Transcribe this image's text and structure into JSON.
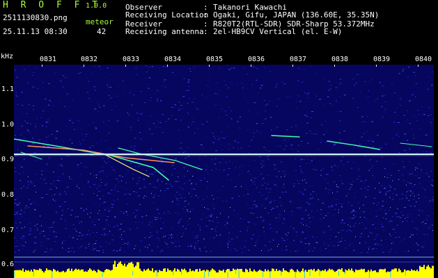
{
  "header": {
    "app_name": "H R O F F T",
    "version": "1.0.0",
    "filename": "2511130830.png",
    "event_type": "meteor",
    "datetime": "25.11.13 08:30",
    "count": "42",
    "fields": [
      {
        "label": "Observer",
        "sep": ":",
        "value": "Takanori Kawachi"
      },
      {
        "label": "Receiving Location",
        "sep": ":",
        "value": "Ogaki, Gifu, JAPAN (136.60E, 35.35N)"
      },
      {
        "label": "Receiver",
        "sep": ":",
        "value": "R820T2(RTL-SDR) SDR-Sharp 53.372MHz"
      },
      {
        "label": "Receiving antenna",
        "sep": ":",
        "value": "2el-HB9CV Vertical (el. E-W)"
      }
    ]
  },
  "axis": {
    "y_unit": "kHz",
    "y_ticks": [
      "1.1",
      "1.0",
      "0.9",
      "0.8",
      "0.7",
      "0.6"
    ],
    "x_ticks": [
      "0831",
      "0832",
      "0833",
      "0834",
      "0835",
      "0836",
      "0837",
      "0838",
      "0839",
      "0840"
    ]
  },
  "colors": {
    "background": "#000000",
    "spectrum_base": "#0a0a7a",
    "carrier": "#c8f0ff",
    "trace": "#40ffb0",
    "bars": "#ffff00",
    "header_green": "#a8ff3a",
    "header_white": "#ffffff"
  }
}
